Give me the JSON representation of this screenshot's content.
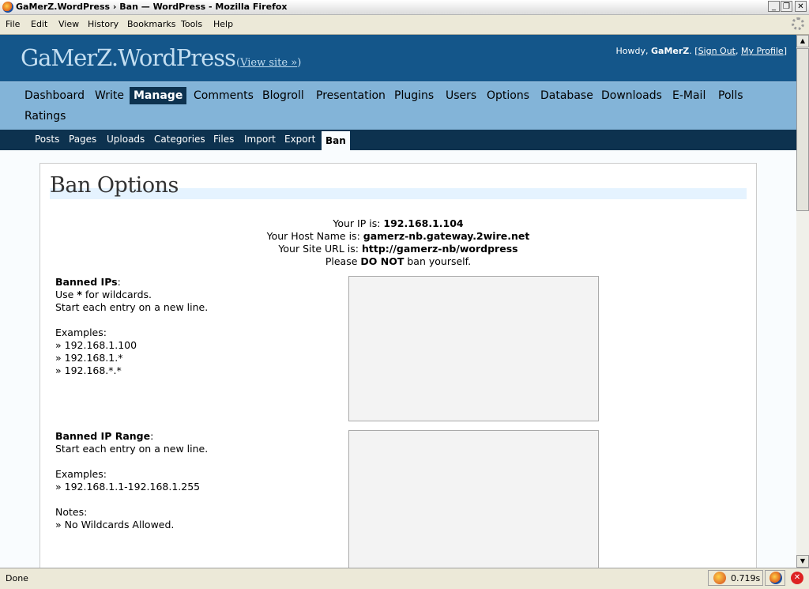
{
  "window": {
    "title": "GaMerZ.WordPress › Ban — WordPress - Mozilla Firefox",
    "controls": {
      "minimize": "_",
      "maximize": "❐",
      "close": "✕"
    }
  },
  "menubar": {
    "items": [
      "File",
      "Edit",
      "View",
      "History",
      "Bookmarks",
      "Tools",
      "Help"
    ]
  },
  "header": {
    "site_title": "GaMerZ.WordPress",
    "view_site": "View site »",
    "user": {
      "howdy": "Howdy,",
      "name": "GaMerZ",
      "sign_out": "Sign Out",
      "my_profile": "My Profile"
    }
  },
  "admin_menu": {
    "items": [
      "Dashboard",
      "Write",
      "Manage",
      "Comments",
      "Blogroll",
      "Presentation",
      "Plugins",
      "Users",
      "Options",
      "Database",
      "Downloads",
      "E-Mail",
      "Polls",
      "Ratings"
    ],
    "current": "Manage"
  },
  "submenu": {
    "items": [
      "Posts",
      "Pages",
      "Uploads",
      "Categories",
      "Files",
      "Import",
      "Export",
      "Ban"
    ],
    "current": "Ban"
  },
  "page": {
    "title": "Ban Options",
    "info": {
      "ip_label": "Your IP is:",
      "ip_value": "192.168.1.104",
      "host_label": "Your Host Name is:",
      "host_value": "gamerz-nb.gateway.2wire.net",
      "url_label": "Your Site URL is:",
      "url_value": "http://gamerz-nb/wordpress",
      "warn_prefix": "Please",
      "warn_strong": "DO NOT",
      "warn_suffix": "ban yourself."
    },
    "banned_ips": {
      "label": "Banned IPs",
      "use": "Use",
      "wildcard": "*",
      "use_suffix": "for wildcards.",
      "line": "Start each entry on a new line.",
      "examples_label": "Examples:",
      "examples": [
        "» 192.168.1.100",
        "» 192.168.1.*",
        "» 192.168.*.*"
      ],
      "value": ""
    },
    "banned_range": {
      "label": "Banned IP Range",
      "line": "Start each entry on a new line.",
      "examples_label": "Examples:",
      "examples": [
        "» 192.168.1.1-192.168.1.255"
      ],
      "notes_label": "Notes:",
      "notes": [
        "» No Wildcards Allowed."
      ],
      "value": ""
    }
  },
  "statusbar": {
    "status": "Done",
    "timing": "0.719s"
  },
  "colors": {
    "header_bg": "#14568a",
    "menu_bg": "#83b4d8",
    "submenu_bg": "#0d324f",
    "page_bg": "#f9fcfe"
  }
}
